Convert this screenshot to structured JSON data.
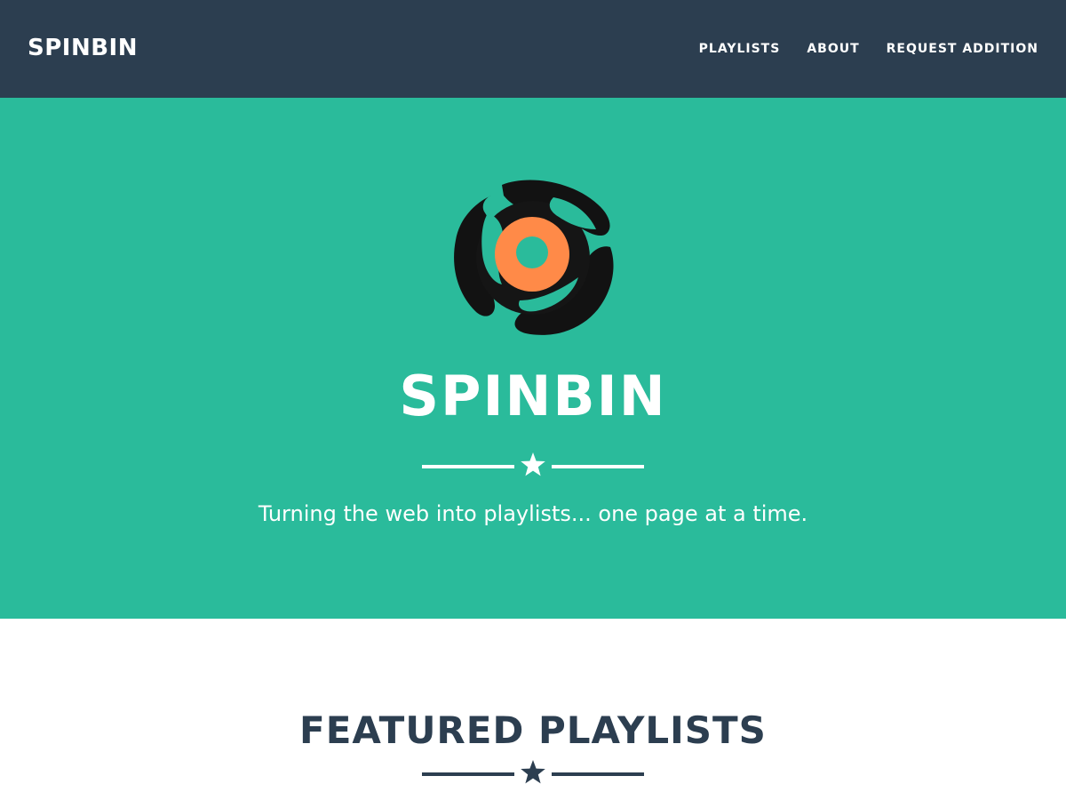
{
  "navbar": {
    "brand": "SPINBIN",
    "links": [
      "PLAYLISTS",
      "ABOUT",
      "REQUEST ADDITION"
    ]
  },
  "hero": {
    "title": "SPINBIN",
    "tagline": "Turning the web into playlists... one page at a time.",
    "logo_icon": "record-adapter-logo"
  },
  "featured": {
    "title": "FEATURED PLAYLISTS"
  },
  "colors": {
    "navbar_bg": "#2c3e50",
    "hero_bg": "#2abb9b",
    "accent_orange": "#ff8a48",
    "text_dark": "#2c3e50",
    "text_light": "#ffffff"
  }
}
